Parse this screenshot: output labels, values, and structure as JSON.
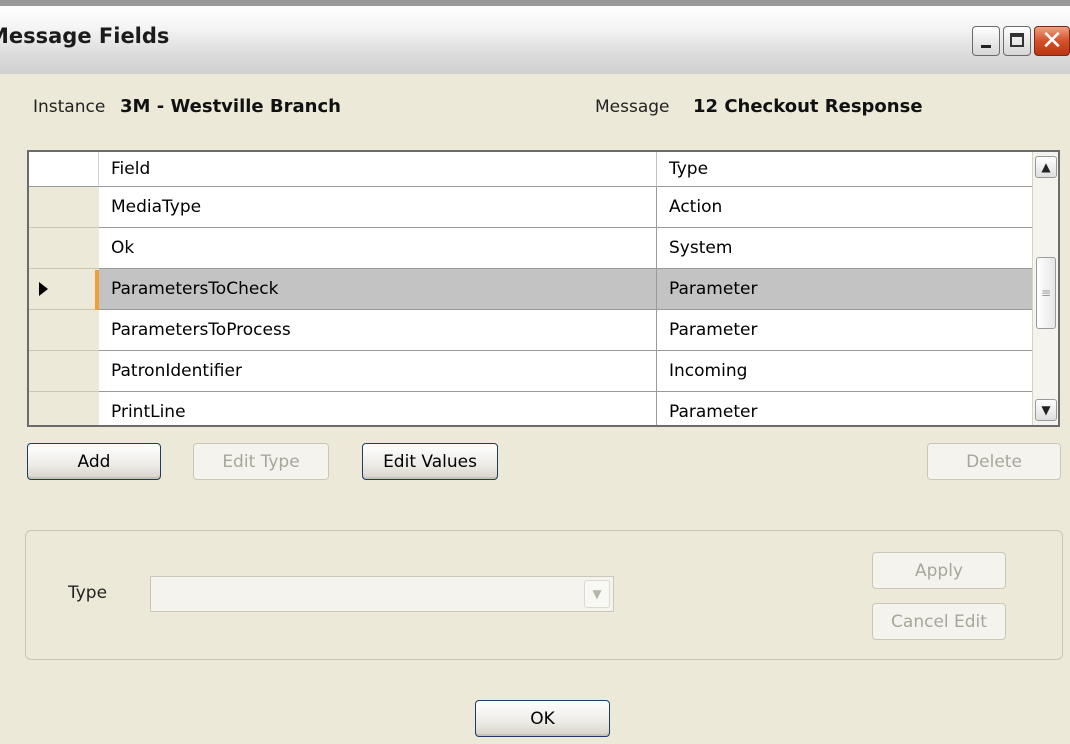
{
  "window": {
    "title": "Message Fields",
    "close_glyph": "✕"
  },
  "info": {
    "instance_label": "Instance",
    "instance_value": "3M - Westville Branch",
    "message_label": "Message",
    "message_value": "12 Checkout Response"
  },
  "grid": {
    "columns": [
      "Field",
      "Type"
    ],
    "rows": [
      {
        "field": "MediaType",
        "type": "Action"
      },
      {
        "field": "Ok",
        "type": "System"
      },
      {
        "field": "ParametersToCheck",
        "type": "Parameter",
        "selected": true
      },
      {
        "field": "ParametersToProcess",
        "type": "Parameter"
      },
      {
        "field": "PatronIdentifier",
        "type": "Incoming"
      },
      {
        "field": "PrintLine",
        "type": "Parameter"
      }
    ],
    "scroll_up_glyph": "▲",
    "scroll_down_glyph": "▼",
    "scroll_thumb_glyph": "≡"
  },
  "buttons": {
    "add": "Add",
    "edit_type": "Edit Type",
    "edit_values": "Edit Values",
    "delete": "Delete",
    "apply": "Apply",
    "cancel_edit": "Cancel Edit",
    "ok": "OK"
  },
  "edit": {
    "type_label": "Type",
    "type_value": "",
    "dropdown_glyph": "▼"
  },
  "colors": {
    "selection": "#c3c3c3",
    "row_marker": "#f0a030",
    "window_bg": "#ece9d8"
  }
}
